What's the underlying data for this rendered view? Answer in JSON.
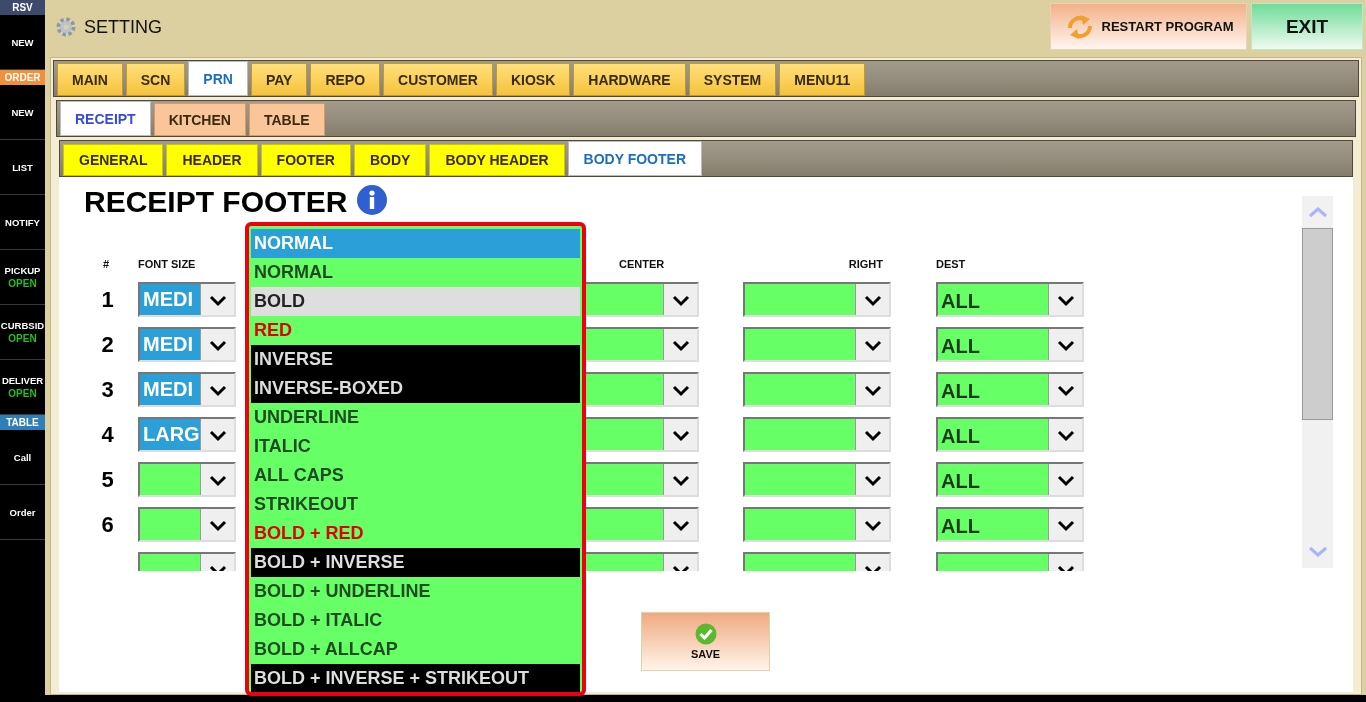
{
  "sidebar": [
    {
      "kind": "header",
      "label": "RSV",
      "color": "#3e4a6b"
    },
    {
      "kind": "button",
      "label": "NEW"
    },
    {
      "kind": "header",
      "label": "ORDER",
      "color": "#f0903a"
    },
    {
      "kind": "button",
      "label": "NEW"
    },
    {
      "kind": "button",
      "label": "LIST"
    },
    {
      "kind": "button",
      "label": "NOTIFY"
    },
    {
      "kind": "button",
      "label": "PICKUP",
      "status": "OPEN"
    },
    {
      "kind": "button",
      "label": "CURBSID",
      "status": "OPEN"
    },
    {
      "kind": "button",
      "label": "DELIVER",
      "status": "OPEN"
    },
    {
      "kind": "header",
      "label": "TABLE",
      "color": "#2e7fb8"
    },
    {
      "kind": "button",
      "label": "Call"
    },
    {
      "kind": "button",
      "label": "Order"
    }
  ],
  "header": {
    "title": "SETTING",
    "buttons": [
      {
        "kind": "restart",
        "label": "RESTART PROGRAM"
      },
      {
        "kind": "exit",
        "label": "EXIT"
      }
    ]
  },
  "tabs": [
    {
      "label": "MAIN",
      "selected": false
    },
    {
      "label": "SCN",
      "selected": false
    },
    {
      "label": "PRN",
      "selected": true
    },
    {
      "label": "PAY",
      "selected": false
    },
    {
      "label": "REPO",
      "selected": false
    },
    {
      "label": "CUSTOMER",
      "selected": false
    },
    {
      "label": "KIOSK",
      "selected": false
    },
    {
      "label": "HARDWARE",
      "selected": false
    },
    {
      "label": "SYSTEM",
      "selected": false
    },
    {
      "label": "MENU11",
      "selected": false
    }
  ],
  "subtabs": [
    {
      "label": "RECEIPT",
      "selected": true
    },
    {
      "label": "KITCHEN",
      "selected": false
    },
    {
      "label": "TABLE",
      "selected": false
    }
  ],
  "section_tabs": [
    {
      "label": "GENERAL",
      "selected": false
    },
    {
      "label": "HEADER",
      "selected": false
    },
    {
      "label": "FOOTER",
      "selected": false
    },
    {
      "label": "BODY",
      "selected": false
    },
    {
      "label": "BODY HEADER",
      "selected": false
    },
    {
      "label": "BODY FOOTER",
      "selected": true
    }
  ],
  "panel": {
    "title": "RECEIPT FOOTER",
    "columns": [
      "#",
      "FONT SIZE",
      "CENTER",
      "RIGHT",
      "DEST"
    ],
    "rows": [
      {
        "number": "1",
        "font_size": "MEDI",
        "dest": "ALL"
      },
      {
        "number": "2",
        "font_size": "MEDI",
        "dest": "ALL"
      },
      {
        "number": "3",
        "font_size": "MEDI",
        "dest": "ALL"
      },
      {
        "number": "4",
        "font_size": "LARG",
        "dest": "ALL"
      },
      {
        "number": "5",
        "dest": "ALL"
      },
      {
        "number": "6",
        "dest": "ALL"
      },
      {}
    ],
    "save_button": "SAVE"
  },
  "dropdown": {
    "value": "NORMAL",
    "options": [
      {
        "label": "NORMAL",
        "kind": "normal",
        "highlighted": false
      },
      {
        "label": "BOLD",
        "kind": "normal",
        "highlighted": true
      },
      {
        "label": "RED",
        "kind": "red",
        "highlighted": false
      },
      {
        "label": "INVERSE",
        "kind": "inverse",
        "highlighted": false
      },
      {
        "label": "INVERSE-BOXED",
        "kind": "inverse",
        "highlighted": false
      },
      {
        "label": "UNDERLINE",
        "kind": "normal",
        "highlighted": false
      },
      {
        "label": "ITALIC",
        "kind": "normal",
        "highlighted": false
      },
      {
        "label": "ALL CAPS",
        "kind": "normal",
        "highlighted": false
      },
      {
        "label": "STRIKEOUT",
        "kind": "normal",
        "highlighted": false
      },
      {
        "label": "BOLD + RED",
        "kind": "red",
        "highlighted": false
      },
      {
        "label": "BOLD + INVERSE",
        "kind": "inverse",
        "highlighted": false
      },
      {
        "label": "BOLD + UNDERLINE",
        "kind": "normal",
        "highlighted": false
      },
      {
        "label": "BOLD + ITALIC",
        "kind": "normal",
        "highlighted": false
      },
      {
        "label": "BOLD + ALLCAP",
        "kind": "normal",
        "highlighted": false
      },
      {
        "label": "BOLD + INVERSE + STRIKEOUT",
        "kind": "inverse",
        "highlighted": false
      }
    ]
  }
}
